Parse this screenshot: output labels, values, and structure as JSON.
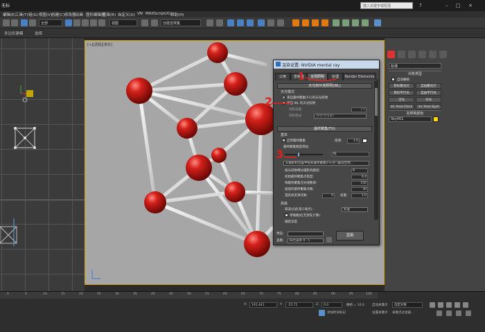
{
  "titlebar": {
    "app_label": "无标",
    "window_title": "",
    "search_placeholder": "键入关键字或短语"
  },
  "menubar": {
    "items": [
      "编辑(E)",
      "工具(T)",
      "组(G)",
      "视图(V)",
      "创建(C)",
      "修改器",
      "动画",
      "图形编辑器",
      "渲染(R)",
      "自定义(U)",
      "VN",
      "MAXScript(X)",
      "帮助(H)"
    ]
  },
  "toolbar": {
    "selection_filter": "全部",
    "view_dropdown": "视图",
    "named_selection": "创建选择集"
  },
  "ribbon": {
    "tabs": [
      "多边形建模",
      "选择"
    ]
  },
  "viewport": {
    "label": "[+][透视][真实]"
  },
  "dialog": {
    "title": "渲染设置: NVIDIA mental ray",
    "tabs": [
      "公用",
      "渲染器",
      "全局照明",
      "处理",
      "Render Elements"
    ],
    "active_tab": "全局照明",
    "rollout_fg": "天光和环境照明(IBL)",
    "section_skylight": "天光模式",
    "opt_from_fg": "来自最终聚集(FG)的天光照明",
    "opt_from_ibl": "来自 IBL 的天光照明",
    "shadow_quality_label": "阴影质量:",
    "shadow_quality_value": "1.0",
    "shadow_mode_label": "阴影模式:",
    "shadow_mode_value": "透明(更准确)",
    "rollout_final": "最终聚集(FG)",
    "section_basic": "基本",
    "enable_fg": "启用最终聚集",
    "multiplier_label": "倍增:",
    "multiplier_value": "1.0",
    "precision_label": "最终聚集精度预设:",
    "precision_value": "低",
    "preset_method": "从摄影机位置中投影最终聚集(FG)点 (最适合用...",
    "divide_label": "按分段数细分摄影机路径:",
    "divide_value": "9",
    "initial_density_label": "初始最终聚集点密度:",
    "initial_density_value": "0.4",
    "rays_label": "每最终聚集点光线数目:",
    "rays_value": "150",
    "interp_label": "插值的最终聚集点数:",
    "interp_value": "30",
    "bounces_label": "漫反射反弹次数:",
    "bounces_value": "0",
    "weight_label": "权重:",
    "weight_value": "1.0",
    "advanced_section": "高级",
    "noise_label": "噪波过滤(减少斑点):",
    "noise_value": "标准",
    "draft_mode": "草稿模式(无预先计算)",
    "trace_depth": "跟踪深度",
    "preset_label": "预设:",
    "view_label": "查看:",
    "view_value": "四元菜单 4 - C",
    "render_button": "渲染"
  },
  "right_panel": {
    "dropdown": "标准",
    "object_type_header": "对象类型",
    "auto_grid": "自动栅格",
    "buttons": [
      "目标聚光灯",
      "自由聚光灯",
      "目标平行光",
      "自由平行光",
      "泛光",
      "天光",
      "mr Area Omni",
      "mr Area Spot"
    ],
    "name_color_header": "名称和颜色",
    "object_name": "Sky001"
  },
  "timeline": {
    "ticks": [
      "0",
      "5",
      "10",
      "15",
      "20",
      "25",
      "30",
      "35",
      "40",
      "45",
      "50",
      "55",
      "60",
      "65",
      "70",
      "75",
      "80",
      "85",
      "90",
      "95",
      "100"
    ]
  },
  "status": {
    "x_label": "X:",
    "x_value": "191.441",
    "y_label": "Y:",
    "y_value": "-25.71",
    "z_label": "Z:",
    "z_value": "0.0",
    "grid_label": "栅格 = 10.0",
    "add_time_tag": "添加时间标记",
    "auto_key": "自动关键点",
    "selected_object": "选定对象",
    "set_key": "设置关键点",
    "key_filter": "关键点过滤器..."
  },
  "annotations": {
    "one": "1",
    "two": "2",
    "three": "3"
  },
  "colors": {
    "sphere": "#cc1a10",
    "stick": "#e0e0e0",
    "viewport_bg": "#a6a6a6",
    "annotation": "#e0201c",
    "highlight_border": "#d9a400"
  }
}
